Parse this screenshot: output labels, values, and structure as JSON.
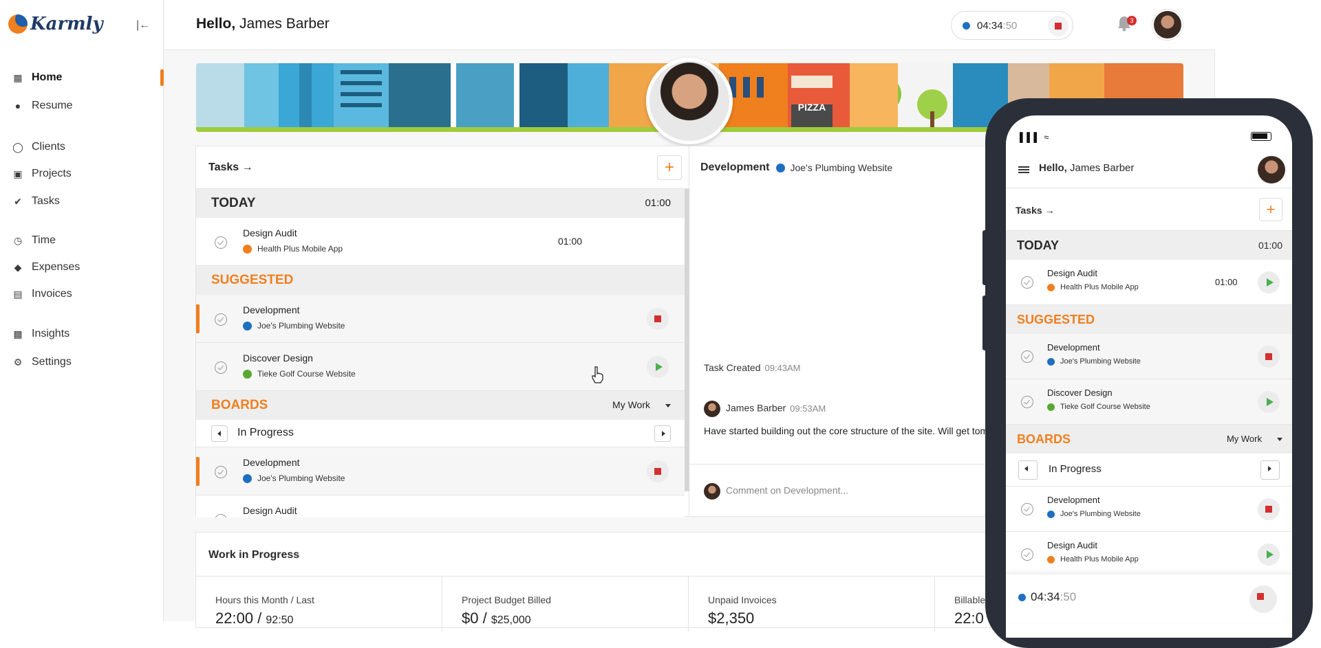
{
  "app": {
    "logo_text": "Karmly"
  },
  "sidebar": {
    "items": [
      {
        "label": "Home",
        "icon": "home-grid-icon",
        "active": true
      },
      {
        "label": "Resume",
        "icon": "person-icon"
      },
      {
        "label": "Clients",
        "icon": "user-circle-icon"
      },
      {
        "label": "Projects",
        "icon": "briefcase-icon"
      },
      {
        "label": "Tasks",
        "icon": "check-circle-icon"
      },
      {
        "label": "Time",
        "icon": "clock-icon"
      },
      {
        "label": "Expenses",
        "icon": "tag-icon"
      },
      {
        "label": "Invoices",
        "icon": "invoice-icon"
      },
      {
        "label": "Insights",
        "icon": "bar-chart-icon"
      },
      {
        "label": "Settings",
        "icon": "gear-icon"
      }
    ]
  },
  "header": {
    "greeting_bold": "Hello,",
    "greeting_name": " James Barber",
    "timer_main": "04:34",
    "timer_seconds": ":50",
    "notification_count": "3"
  },
  "tasks_panel": {
    "title": "Tasks",
    "add_label": "+",
    "today": {
      "label": "TODAY",
      "total": "01:00"
    },
    "today_tasks": [
      {
        "name": "Design Audit",
        "project": "Health Plus Mobile App",
        "time": "01:00"
      }
    ],
    "suggested_label": "SUGGESTED",
    "suggested_tasks": [
      {
        "name": "Development",
        "project": "Joe's Plumbing Website"
      },
      {
        "name": "Discover Design",
        "project": "Tieke Golf Course Website"
      }
    ],
    "boards": {
      "label": "BOARDS",
      "filter": "My Work",
      "board_name": "In Progress"
    },
    "board_tasks": [
      {
        "name": "Development",
        "project": "Joe's Plumbing Website"
      },
      {
        "name": "Design Audit",
        "project": "Health Plus Mobile App"
      }
    ]
  },
  "detail_panel": {
    "task": "Development",
    "project": "Joe's Plumbing Website",
    "created_label": "Task Created",
    "created_time": "09:43AM",
    "author": "James Barber",
    "comment_time": "09:53AM",
    "comment_text": "Have started building out the core structure of the site. Will get tomorrow.",
    "comment_placeholder": "Comment on Development..."
  },
  "wip": {
    "title": "Work in Progress",
    "stats": [
      {
        "label": "Hours this Month / Last",
        "value": "22:00",
        "sep": " / ",
        "secondary": "92:50"
      },
      {
        "label": "Project Budget Billed",
        "value": "$0",
        "sep": " / ",
        "secondary": "$25,000"
      },
      {
        "label": "Unpaid Invoices",
        "value": "$2,350",
        "sep": "",
        "secondary": ""
      },
      {
        "label": "Billable",
        "value": "22:0",
        "sep": "",
        "secondary": ""
      }
    ]
  },
  "banner": {
    "sign_text": "PIZZA"
  },
  "colors": {
    "accent": "#f07f1e",
    "blue_project": "#1f6fc0",
    "orange_project": "#f07f1e",
    "green_project": "#5aa832",
    "stop": "#d32f2f",
    "play": "#4caf50"
  }
}
